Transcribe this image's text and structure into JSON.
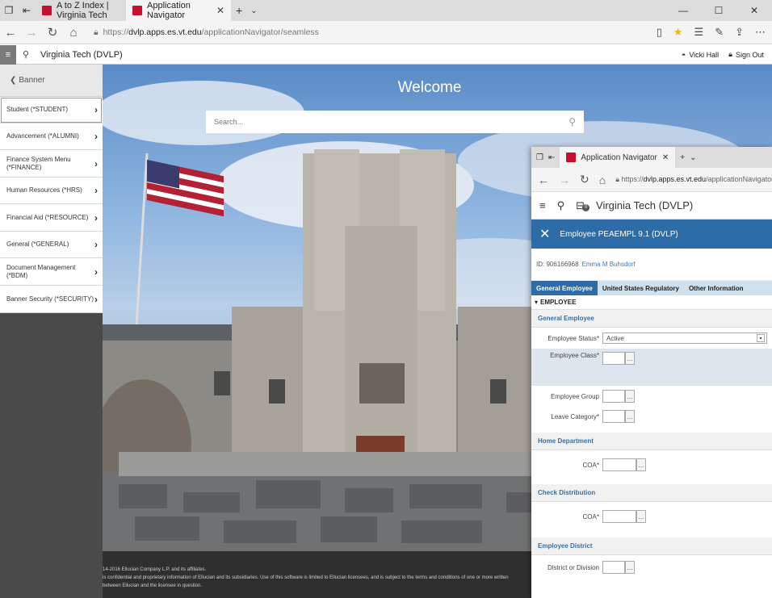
{
  "browser": {
    "tabs": [
      {
        "label": "A to Z Index | Virginia Tech",
        "active": false
      },
      {
        "label": "Application Navigator",
        "active": true
      }
    ],
    "url_prefix": "https://",
    "url_host": "dvlp.apps.es.vt.edu",
    "url_path": "/applicationNavigator/seamless"
  },
  "app": {
    "title": "Virginia Tech (DVLP)",
    "user": "Vicki Hall",
    "signout": "Sign Out"
  },
  "sidebar": {
    "back_label": "Banner",
    "items": [
      {
        "label": "Student (*STUDENT)"
      },
      {
        "label": "Advancement (*ALUMNI)"
      },
      {
        "label": "Finance System Menu (*FINANCE)"
      },
      {
        "label": "Human Resources (*HRS)"
      },
      {
        "label": "Financial Aid (*RESOURCE)"
      },
      {
        "label": "General (*GENERAL)"
      },
      {
        "label": "Document Management (*BDM)"
      },
      {
        "label": "Banner Security (*SECURITY)"
      }
    ]
  },
  "main": {
    "welcome": "Welcome",
    "search_placeholder": "Search...",
    "footer_line1": "14-2016 Ellucian Company L.P. and its affiliates.",
    "footer_line2": "is confidential and proprietary information of Ellucian and its subsidiaries. Use of this software is limited to Ellucian licensees, and is subject to the terms and conditions of one or more written",
    "footer_line3": "between Ellucian and the licensee in question."
  },
  "overlay": {
    "tab_label": "Application Navigator",
    "url_prefix": "https://",
    "url_host": "dvlp.apps.es.vt.edu",
    "url_path": "/applicationNavigator/s",
    "app_title": "Virginia Tech (DVLP)",
    "badge": "0",
    "form_title": "Employee PEAEMPL 9.1 (DVLP)",
    "id_label": "ID:",
    "id_value": "906166968",
    "id_name": "Emma M Buhsdorf",
    "tabs": [
      "General Employee",
      "United States Regulatory",
      "Other Information"
    ],
    "section": "EMPLOYEE",
    "groups": {
      "general": "General Employee",
      "home": "Home Department",
      "check": "Check Distribution",
      "district": "Employee District"
    },
    "fields": {
      "status_label": "Employee Status",
      "status_value": "Active",
      "class_label": "Employee Class",
      "group_label": "Employee Group",
      "leave_label": "Leave Category",
      "coa_label": "COA",
      "district_label": "District or Division",
      "required_mark": "*",
      "lookup": "..."
    }
  },
  "colors": {
    "accent_blue": "#2d6ca6",
    "sidebar_dark": "#4a4a4a",
    "tab_brand": "#c8102e"
  }
}
